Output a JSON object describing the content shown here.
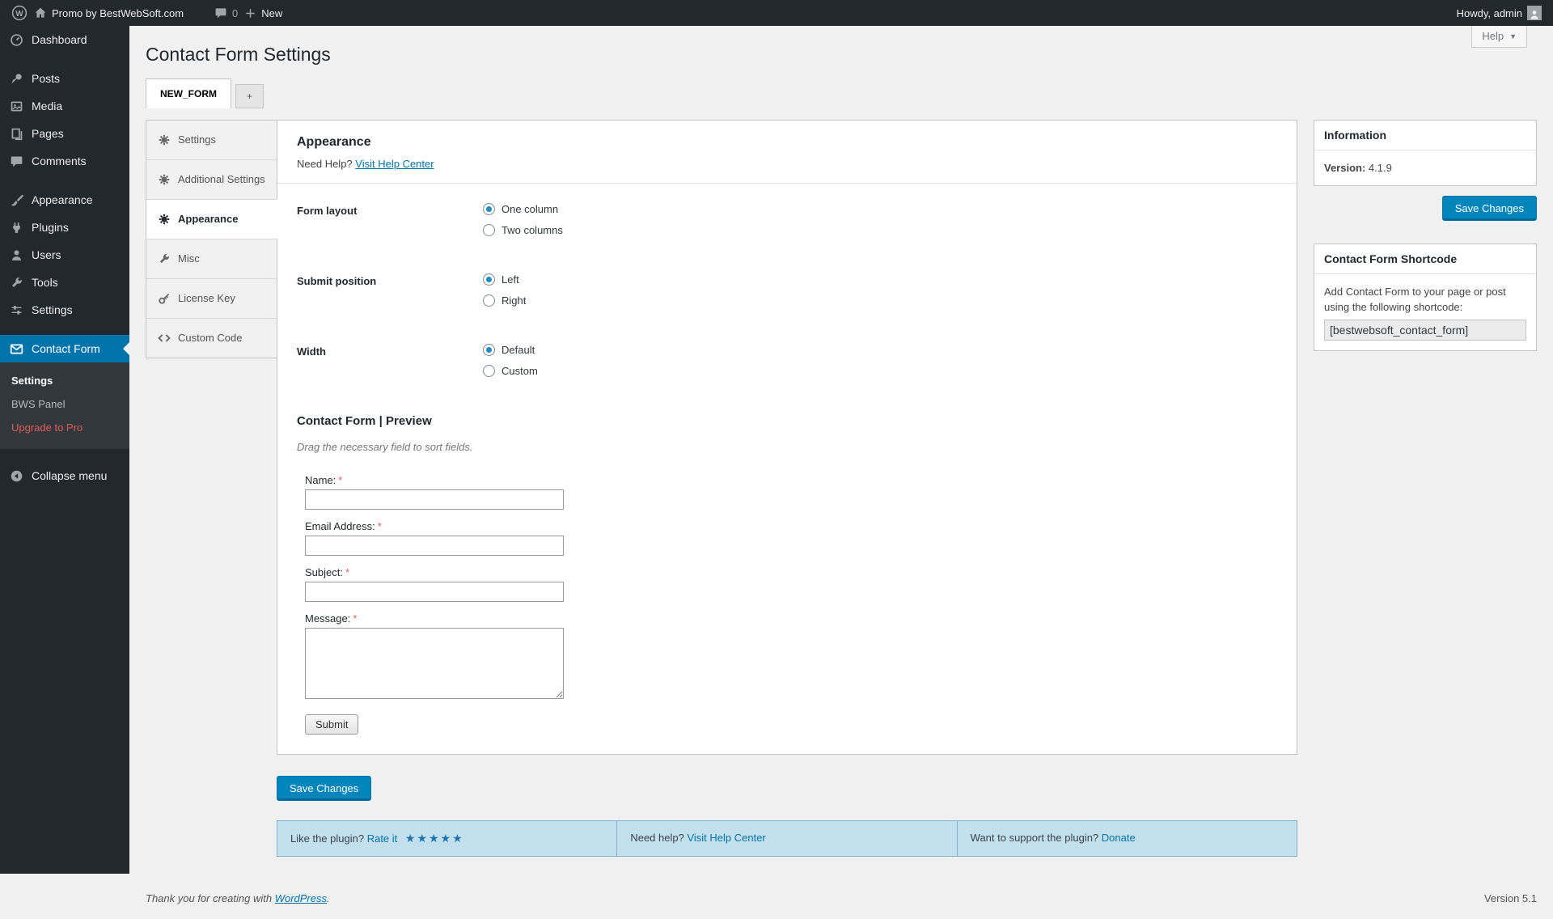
{
  "colors": {
    "adminbar_bg": "#23282d",
    "accent": "#0073aa",
    "primary_button": "#0085ba",
    "notice_bg": "#c3e0ef",
    "upgrade_red": "#e35b5b"
  },
  "admin_bar": {
    "site_name": "Promo by BestWebSoft.com",
    "comments_count": "0",
    "new_label": "New",
    "howdy": "Howdy, admin"
  },
  "sidebar": {
    "items": [
      {
        "label": "Dashboard",
        "icon": "dashboard-icon",
        "active": false
      },
      {
        "label": "Posts",
        "icon": "pin-icon",
        "active": false
      },
      {
        "label": "Media",
        "icon": "media-icon",
        "active": false
      },
      {
        "label": "Pages",
        "icon": "pages-icon",
        "active": false
      },
      {
        "label": "Comments",
        "icon": "comment-icon",
        "active": false
      },
      {
        "label": "Appearance",
        "icon": "brush-icon",
        "active": false
      },
      {
        "label": "Plugins",
        "icon": "plugin-icon",
        "active": false
      },
      {
        "label": "Users",
        "icon": "user-icon",
        "active": false
      },
      {
        "label": "Tools",
        "icon": "wrench-icon",
        "active": false
      },
      {
        "label": "Settings",
        "icon": "sliders-icon",
        "active": false
      },
      {
        "label": "Contact Form",
        "icon": "envelope-icon",
        "active": true
      }
    ],
    "submenu": [
      {
        "label": "Settings",
        "current": true
      },
      {
        "label": "BWS Panel",
        "current": false
      },
      {
        "label": "Upgrade to Pro",
        "highlight": true
      }
    ],
    "collapse_label": "Collapse menu"
  },
  "page": {
    "title": "Contact Form Settings",
    "help_label": "Help",
    "tabs": [
      {
        "label": "NEW_FORM",
        "active": true
      },
      {
        "label": "+",
        "active": false
      }
    ]
  },
  "settings_nav": {
    "items": [
      {
        "label": "Settings",
        "icon": "gear-icon",
        "active": false
      },
      {
        "label": "Additional Settings",
        "icon": "gear-icon",
        "active": false
      },
      {
        "label": "Appearance",
        "icon": "gear-icon",
        "active": true
      },
      {
        "label": "Misc",
        "icon": "wrench-icon",
        "active": false
      },
      {
        "label": "License Key",
        "icon": "key-icon",
        "active": false
      },
      {
        "label": "Custom Code",
        "icon": "code-icon",
        "active": false
      }
    ]
  },
  "panel": {
    "heading": "Appearance",
    "need_help": "Need Help?",
    "help_link": "Visit Help Center",
    "groups": [
      {
        "label": "Form layout",
        "options": [
          {
            "label": "One column",
            "selected": true
          },
          {
            "label": "Two columns",
            "selected": false
          }
        ]
      },
      {
        "label": "Submit position",
        "options": [
          {
            "label": "Left",
            "selected": true
          },
          {
            "label": "Right",
            "selected": false
          }
        ]
      },
      {
        "label": "Width",
        "options": [
          {
            "label": "Default",
            "selected": true
          },
          {
            "label": "Custom",
            "selected": false
          }
        ]
      }
    ],
    "preview": {
      "title": "Contact Form | Preview",
      "note": "Drag the necessary field to sort fields.",
      "fields": [
        {
          "label": "Name:",
          "required": "*",
          "type": "text"
        },
        {
          "label": "Email Address:",
          "required": "*",
          "type": "text"
        },
        {
          "label": "Subject:",
          "required": "*",
          "type": "text"
        },
        {
          "label": "Message:",
          "required": "*",
          "type": "textarea"
        }
      ],
      "submit_label": "Submit"
    },
    "save_button": "Save Changes"
  },
  "info_box": {
    "title": "Information",
    "version_label": "Version:",
    "version_value": "4.1.9",
    "save_button": "Save Changes"
  },
  "shortcode_box": {
    "title": "Contact Form Shortcode",
    "description": "Add Contact Form to your page or post using the following shortcode:",
    "shortcode": "[bestwebsoft_contact_form]"
  },
  "notice_bar": {
    "cells": [
      {
        "text": "Like the plugin?",
        "link": "Rate it",
        "stars": "★★★★★"
      },
      {
        "text": "Need help?",
        "link": "Visit Help Center",
        "stars": ""
      },
      {
        "text": "Want to support the plugin?",
        "link": "Donate",
        "stars": ""
      }
    ]
  },
  "footer": {
    "thanks_text": "Thank you for creating with",
    "link": "WordPress",
    "suffix": ".",
    "version": "Version 5.1"
  }
}
